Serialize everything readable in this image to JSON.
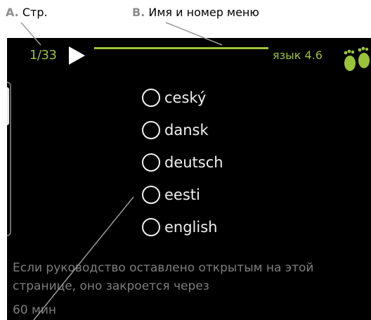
{
  "callouts": {
    "a": {
      "letter": "A.",
      "text": "Стр."
    },
    "b": {
      "letter": "B.",
      "text": "Имя и номер меню"
    }
  },
  "header": {
    "page_indicator": "1/33",
    "menu_title": "язык 4.6"
  },
  "languages": [
    {
      "label": "cеský",
      "selected": false
    },
    {
      "label": "dansk",
      "selected": false
    },
    {
      "label": "deutsch",
      "selected": false
    },
    {
      "label": "eesti",
      "selected": false
    },
    {
      "label": "english",
      "selected": false
    }
  ],
  "info": {
    "line": "Если руководство оставлено открытым на этой странице, оно закроется через",
    "timer": "60 мин"
  },
  "colors": {
    "accent": "#9bc33a",
    "screen_bg": "#000000",
    "option_text": "#f0f0f0",
    "info_text": "#7e7e7e",
    "callout_letter": "#8c8c8c"
  },
  "icons": {
    "next": "right-arrow-icon",
    "help": "footprints-icon",
    "radio": "radio-unselected-icon"
  }
}
